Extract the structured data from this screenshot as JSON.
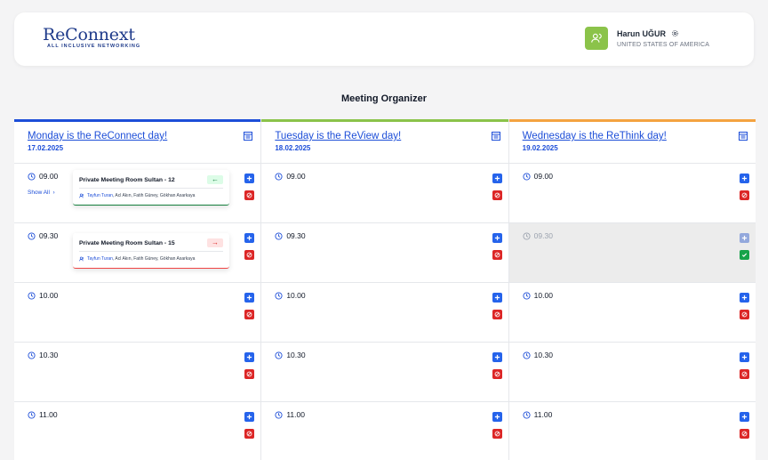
{
  "brand": {
    "name": "ReConnext",
    "tagline": "ALL INCLUSIVE NETWORKING"
  },
  "user": {
    "name": "Harun UĞUR",
    "country": "UNITED STATES OF AMERICA"
  },
  "page": {
    "title": "Meeting Organizer"
  },
  "colors": {
    "monday": "#1d4ed8",
    "tuesday": "#8bc34a",
    "wednesday": "#f4a340",
    "add": "#2563eb",
    "block": "#dc2626",
    "ok": "#16a34a"
  },
  "days": [
    {
      "title": "Monday is the ReConnect day!",
      "date": "17.02.2025",
      "slots": [
        {
          "time": "09.00",
          "show_all": "Show All",
          "meeting": {
            "room": "Private Meeting Room Sultan - 12",
            "direction": "in",
            "host": "Tayfun Turan",
            "others": ", Acl Akın, Fatih Güney, Gökhan Asarkaya"
          }
        },
        {
          "time": "09.30",
          "meeting": {
            "room": "Private Meeting Room Sultan - 15",
            "direction": "out",
            "host": "Tayfun Turan",
            "others": ", Acl Akın, Fatih Güney, Gökhan Asarkaya"
          }
        },
        {
          "time": "10.00"
        },
        {
          "time": "10.30"
        },
        {
          "time": "11.00"
        }
      ]
    },
    {
      "title": "Tuesday is the ReView day!",
      "date": "18.02.2025",
      "slots": [
        {
          "time": "09.00"
        },
        {
          "time": "09.30"
        },
        {
          "time": "10.00"
        },
        {
          "time": "10.30"
        },
        {
          "time": "11.00"
        }
      ]
    },
    {
      "title": "Wednesday is the ReThink day!",
      "date": "19.02.2025",
      "slots": [
        {
          "time": "09.00"
        },
        {
          "time": "09.30",
          "disabled": true
        },
        {
          "time": "10.00"
        },
        {
          "time": "10.30"
        },
        {
          "time": "11.00"
        }
      ]
    }
  ]
}
